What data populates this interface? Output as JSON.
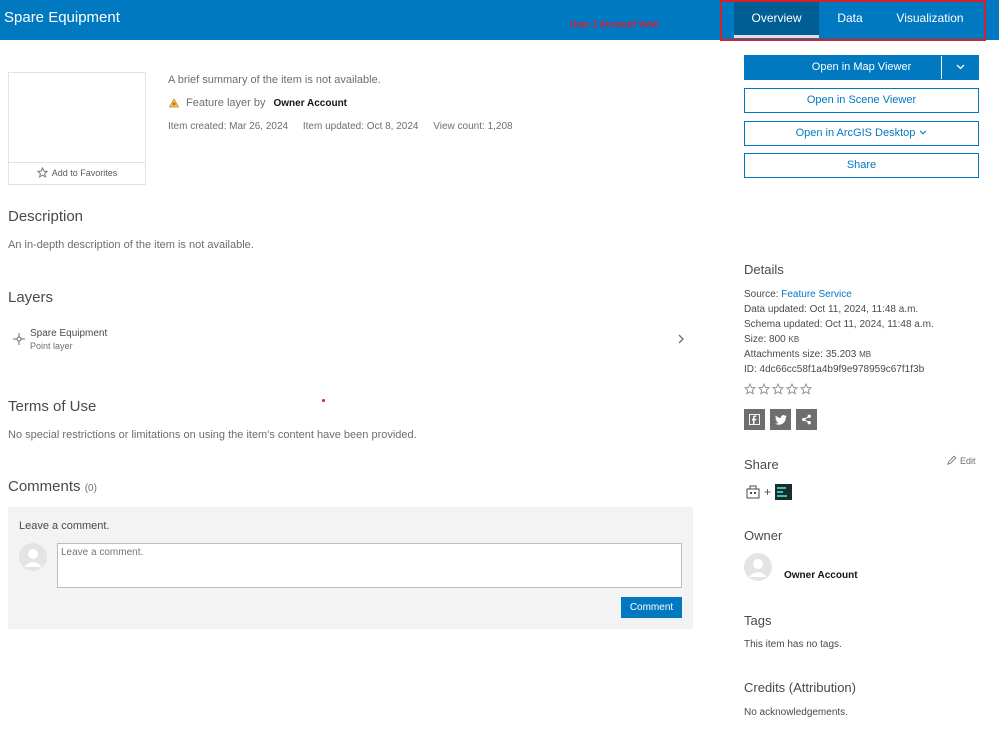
{
  "header": {
    "title": "Spare Equipment",
    "annotation": "User 1 Account View",
    "tabs": [
      {
        "label": "Overview",
        "active": true
      },
      {
        "label": "Data",
        "active": false
      },
      {
        "label": "Visualization",
        "active": false
      }
    ]
  },
  "item": {
    "favorites_label": "Add to Favorites",
    "summary": "A brief summary of the item is not available.",
    "type_prefix": "Feature layer by",
    "owner": "Owner Account",
    "created": "Item created: Mar 26, 2024",
    "updated": "Item updated: Oct 8, 2024",
    "views": "View count: 1,208"
  },
  "description": {
    "heading": "Description",
    "text": "An in-depth description of the item is not available."
  },
  "layers": {
    "heading": "Layers",
    "items": [
      {
        "name": "Spare Equipment",
        "type": "Point layer"
      }
    ]
  },
  "terms": {
    "heading": "Terms of Use",
    "text": "No special restrictions or limitations on using the item's content have been provided."
  },
  "comments": {
    "heading": "Comments",
    "count": "(0)",
    "prompt": "Leave a comment.",
    "placeholder": "Leave a comment.",
    "button": "Comment"
  },
  "actions": {
    "map_viewer": "Open in Map Viewer",
    "scene_viewer": "Open in Scene Viewer",
    "arcgis_desktop": "Open in ArcGIS Desktop",
    "share": "Share"
  },
  "details": {
    "heading": "Details",
    "source_label": "Source: ",
    "source_value": "Feature Service",
    "data_updated": "Data updated: Oct 11, 2024, 11:48 a.m.",
    "schema_updated": "Schema updated: Oct 11, 2024, 11:48 a.m.",
    "size_label": "Size: 800 ",
    "size_unit": "KB",
    "attachments_label": "Attachments size: 35.203 ",
    "attachments_unit": "MB",
    "id": "ID: 4dc66cc58f1a4b9f9e978959c67f1f3b",
    "rating": 0
  },
  "share_section": {
    "heading": "Share",
    "edit_label": "Edit",
    "plus": "+"
  },
  "owner_section": {
    "heading": "Owner",
    "name": "Owner Account"
  },
  "tags": {
    "heading": "Tags",
    "text": "This item has no tags."
  },
  "credits": {
    "heading": "Credits (Attribution)",
    "text": "No acknowledgements."
  },
  "colors": {
    "brand_blue": "#0079c1",
    "annotation_red": "#d7202d"
  }
}
